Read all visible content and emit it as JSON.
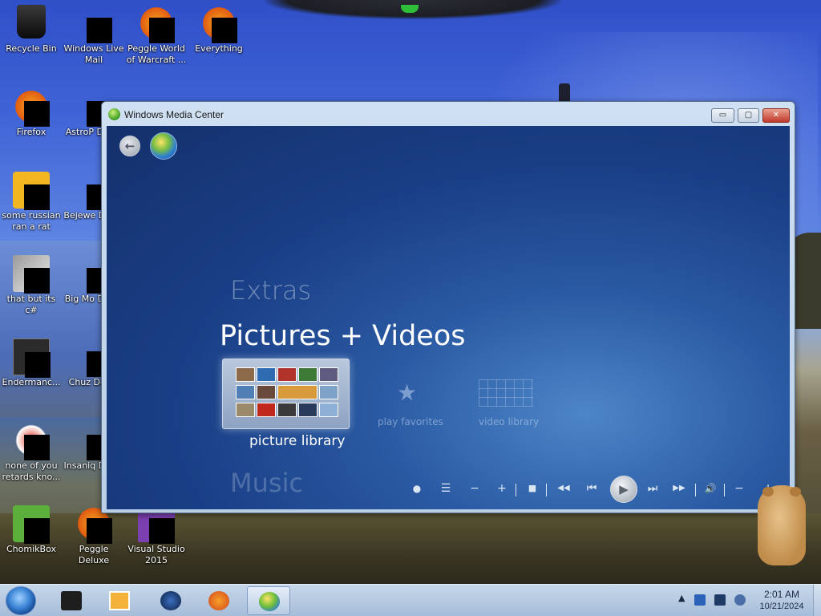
{
  "desktop": {
    "icons": [
      {
        "label": "Recycle Bin",
        "glyph": "recycle-bin-icon"
      },
      {
        "label": "Windows Live Mail",
        "glyph": "windows-live-mail-icon"
      },
      {
        "label": "Peggle World of Warcraft ...",
        "glyph": "peggle-wow-icon"
      },
      {
        "label": "Everything",
        "glyph": "everything-search-icon"
      },
      {
        "label": "Firefox",
        "glyph": "firefox-icon"
      },
      {
        "label": "AstroP Delux",
        "glyph": "astropop-icon"
      },
      {
        "label": "some russian ran a rat",
        "glyph": "yellow-app-icon"
      },
      {
        "label": "Bejewe Delux",
        "glyph": "bejeweled-icon"
      },
      {
        "label": "that but its c#",
        "glyph": "copy-stack-icon"
      },
      {
        "label": "Big Mo Delux",
        "glyph": "bigmoney-icon"
      },
      {
        "label": "Endermanc...",
        "glyph": "terminal-icon"
      },
      {
        "label": "Chuz Delux",
        "glyph": "chuzzle-icon"
      },
      {
        "label": "none of you retards kno...",
        "glyph": "opera-icon"
      },
      {
        "label": "Insaniq Delux",
        "glyph": "insaniquarium-icon"
      },
      {
        "label": "ChomikBox",
        "glyph": "chomikbox-icon"
      },
      {
        "label": "Peggle Deluxe",
        "glyph": "peggle-icon"
      },
      {
        "label": "Visual Studio 2015",
        "glyph": "visual-studio-icon"
      }
    ]
  },
  "window": {
    "title": "Windows Media Center",
    "min_label": "▭",
    "max_label": "▢",
    "close_label": "✕"
  },
  "wmc": {
    "back_label": "←",
    "menu": {
      "extras": "Extras",
      "current": "Pictures + Videos",
      "next": "Music"
    },
    "tiles": [
      {
        "label": "picture library",
        "icon": "picture-library-icon",
        "selected": true
      },
      {
        "label": "play favorites",
        "icon": "star-icon",
        "selected": false
      },
      {
        "label": "video library",
        "icon": "video-grid-icon",
        "selected": false
      }
    ],
    "transport": {
      "record": "●",
      "guide": "☰",
      "channel_down": "−",
      "channel_up": "+",
      "stop": "■",
      "rewind": "◀◀",
      "previous": "⏮",
      "play": "▶",
      "next": "⏭",
      "fast_forward": "▶▶",
      "mute": "🔊",
      "volume_down": "−",
      "volume_up": "+"
    }
  },
  "taskbar": {
    "items": [
      "windows-explorer-icon",
      "media-player-icon",
      "globe-icon",
      "firefox-icon",
      "media-center-icon"
    ],
    "tray_arrow": "▲",
    "clock_time": "2:01 AM",
    "clock_date": "10/21/2024"
  },
  "colors": {
    "accent": "#1a3f86",
    "taskbar": "#b5c9e0"
  }
}
